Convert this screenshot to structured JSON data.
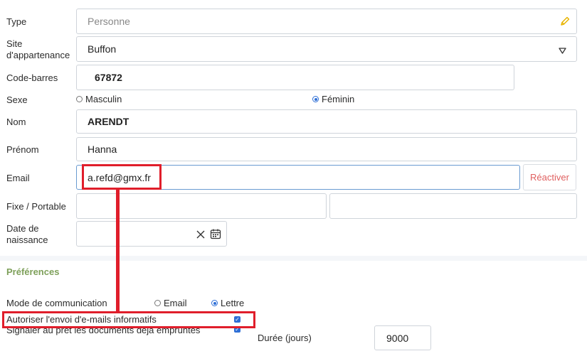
{
  "form": {
    "type": {
      "label": "Type",
      "value": "Personne"
    },
    "site": {
      "label": "Site d'appartenance",
      "value": "Buffon"
    },
    "barcode": {
      "label": "Code-barres",
      "value": "67872"
    },
    "sex": {
      "label": "Sexe",
      "options": [
        "Masculin",
        "Féminin"
      ],
      "selected": "Féminin"
    },
    "lastname": {
      "label": "Nom",
      "value": "ARENDT"
    },
    "firstname": {
      "label": "Prénom",
      "value": "Hanna"
    },
    "email": {
      "label": "Email",
      "value": "a.refd@gmx.fr",
      "reactivate": "Réactiver"
    },
    "phone": {
      "label": "Fixe / Portable",
      "value1": "",
      "value2": ""
    },
    "birth": {
      "label": "Date de naissance",
      "value": ""
    }
  },
  "preferences": {
    "title": "Préférences",
    "comm_mode": {
      "label": "Mode de communication",
      "options": [
        "Email",
        "Lettre"
      ],
      "selected": "Lettre"
    },
    "allow_info_emails": {
      "label": "Autoriser l'envoi d'e-mails informatifs",
      "checked": true
    },
    "signal_borrowed": {
      "label": "Signaler au pret les documents deja empruntes",
      "checked": true
    },
    "duration": {
      "label": "Durée (jours)",
      "value": "9000"
    }
  },
  "colors": {
    "accent": "#2f6fd6",
    "section": "#7ea05a",
    "annotation": "#e01e2b",
    "reactivate": "#e06060"
  }
}
